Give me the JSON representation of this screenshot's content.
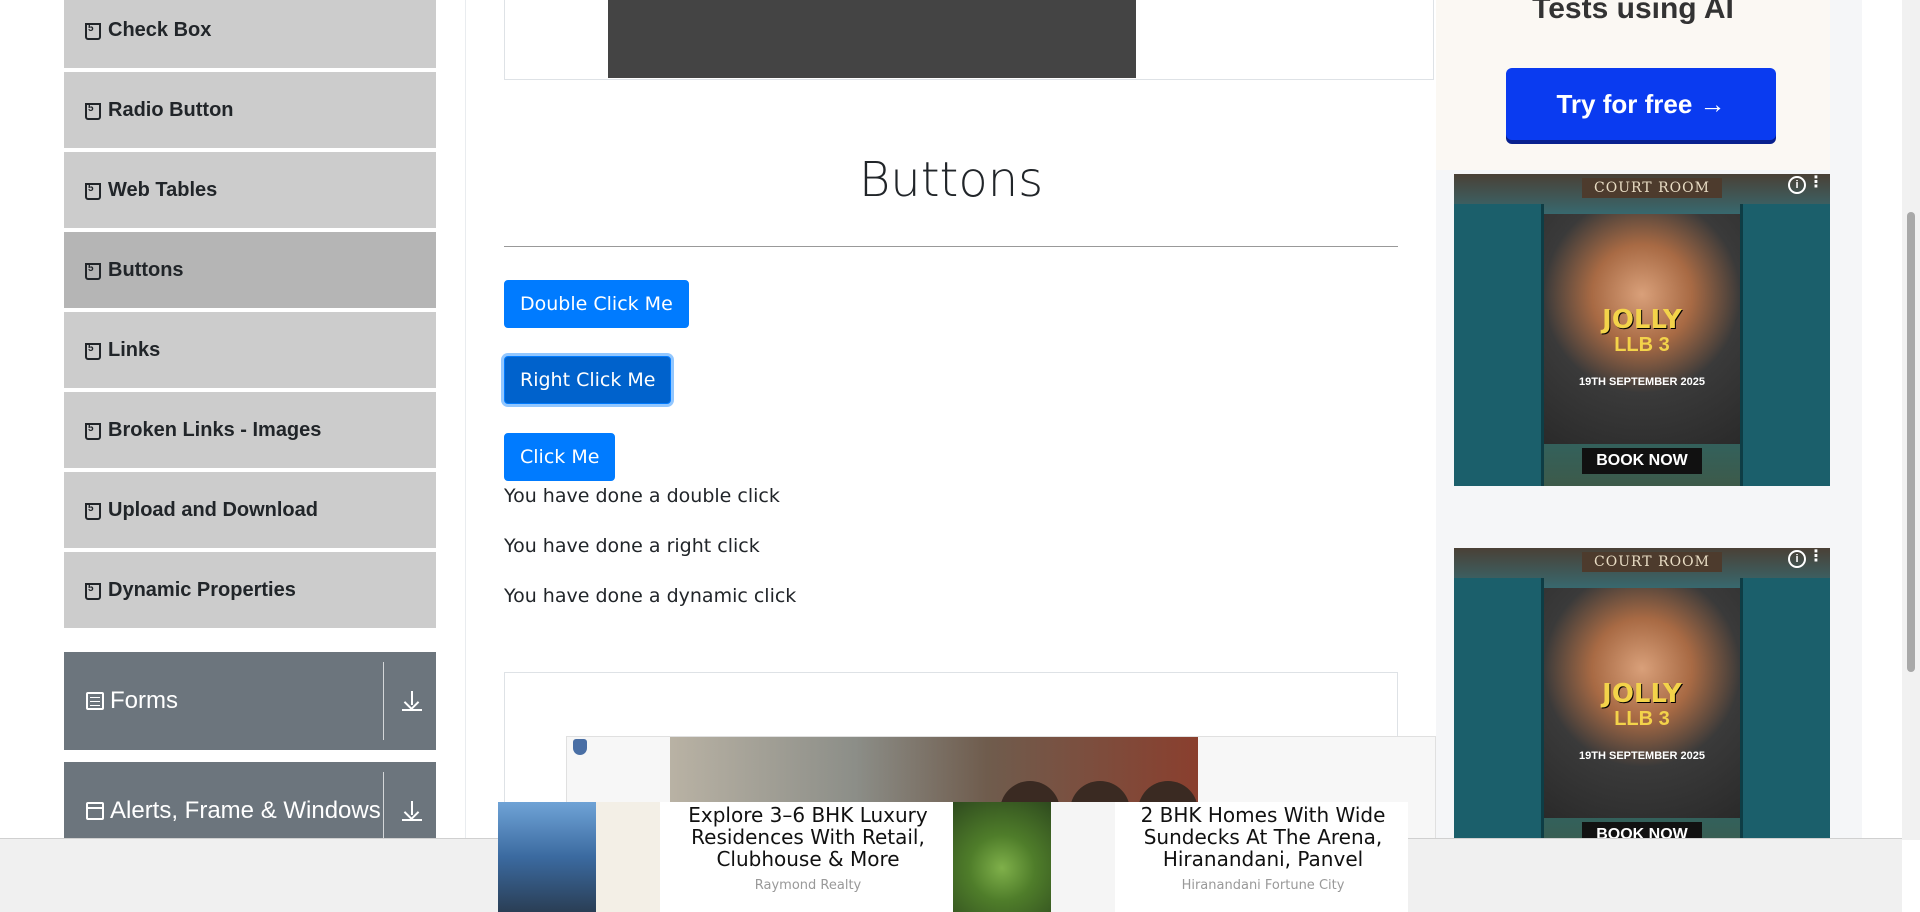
{
  "sidebar": {
    "items": [
      {
        "label": "Check Box",
        "active": false
      },
      {
        "label": "Radio Button",
        "active": false
      },
      {
        "label": "Web Tables",
        "active": false
      },
      {
        "label": "Buttons",
        "active": true
      },
      {
        "label": "Links",
        "active": false
      },
      {
        "label": "Broken Links - Images",
        "active": false
      },
      {
        "label": "Upload and Download",
        "active": false
      },
      {
        "label": "Dynamic Properties",
        "active": false
      }
    ],
    "groups": [
      {
        "label": "Forms",
        "icon": "form-icon"
      },
      {
        "label": "Alerts, Frame & Windows",
        "icon": "window-icon"
      }
    ]
  },
  "main": {
    "title": "Buttons",
    "buttons": {
      "double_click": "Double Click Me",
      "right_click": "Right Click Me",
      "click": "Click Me"
    },
    "messages": {
      "double": "You have done a double click",
      "right": "You have done a right click",
      "dynamic": "You have done a dynamic click"
    }
  },
  "right_ads": {
    "ai_ad": {
      "headline": "Tests using AI",
      "cta": "Try for free →"
    },
    "movie_ad": {
      "sign": "COURT ROOM",
      "title": "JOLLY",
      "subtitle": "LLB 3",
      "date": "19TH SEPTEMBER 2025",
      "cta": "BOOK NOW"
    }
  },
  "bottom_ads": [
    {
      "headline": "Explore 3–6 BHK Luxury Residences With Retail, Clubhouse & More",
      "source": "Raymond Realty"
    },
    {
      "headline": "2 BHK Homes With Wide Sundecks At The Arena, Hiranandani, Panvel",
      "source": "Hiranandani Fortune City"
    }
  ],
  "colors": {
    "primary": "#007bff",
    "sidebar_item": "#cccccc",
    "sidebar_active": "#b5b5b5",
    "group_header": "#6c757d",
    "cta_blue": "#0a3bf0"
  }
}
